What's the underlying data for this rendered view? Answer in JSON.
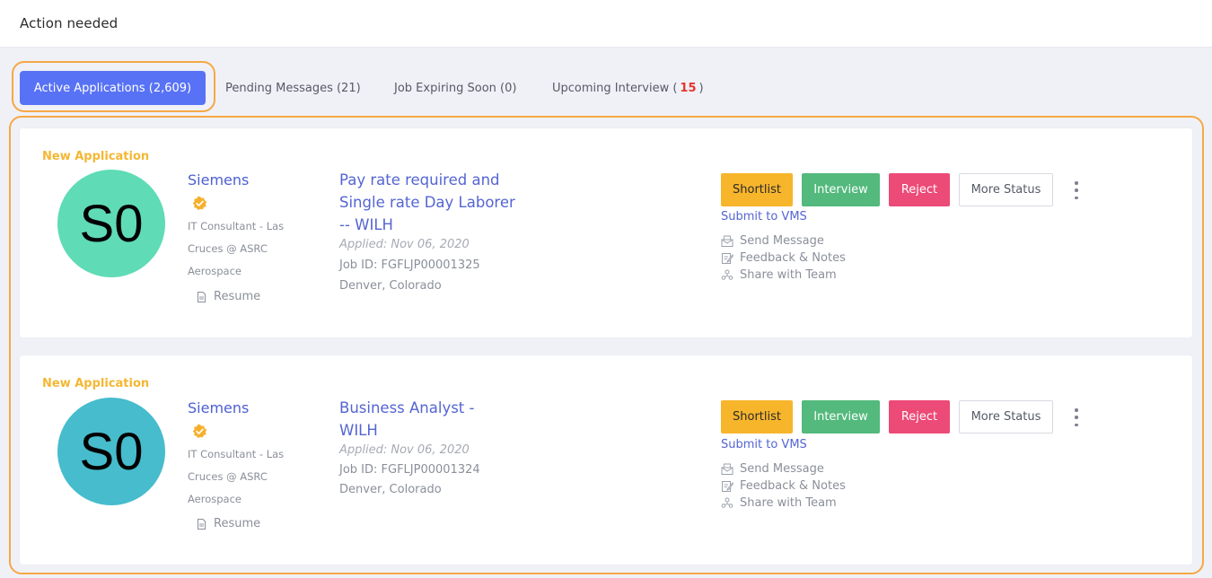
{
  "header": {
    "title": "Action needed"
  },
  "tabs": [
    {
      "label": "Active Applications (2,609)"
    },
    {
      "label": "Pending Messages (21)"
    },
    {
      "label": "Job Expiring Soon (0)"
    },
    {
      "label_prefix": "Upcoming Interview (",
      "count": "15",
      "label_suffix": ")"
    }
  ],
  "cards": [
    {
      "badge": "New Application",
      "avatar": {
        "initials": "S0",
        "color": "#5fdbb6"
      },
      "company": "Siemens",
      "role_lines": [
        "IT Consultant - Las",
        "Cruces @ ASRC",
        "Aerospace"
      ],
      "resume_label": "Resume",
      "job_title": "Pay rate required and Single rate Day Laborer -- WILH",
      "applied": "Applied: Nov 06, 2020",
      "job_id": "Job ID: FGFLJP00001325",
      "location": "Denver, Colorado",
      "buttons": {
        "shortlist": "Shortlist",
        "interview": "Interview",
        "reject": "Reject",
        "more_status": "More Status"
      },
      "submit_vms": "Submit to VMS",
      "actions": {
        "send_message": "Send Message",
        "feedback": "Feedback & Notes",
        "share": "Share with Team"
      }
    },
    {
      "badge": "New Application",
      "avatar": {
        "initials": "S0",
        "color": "#46bccd"
      },
      "company": "Siemens",
      "role_lines": [
        "IT Consultant - Las",
        "Cruces @ ASRC",
        "Aerospace"
      ],
      "resume_label": "Resume",
      "job_title": "Business Analyst - WILH",
      "applied": "Applied: Nov 06, 2020",
      "job_id": "Job ID: FGFLJP00001324",
      "location": "Denver, Colorado",
      "buttons": {
        "shortlist": "Shortlist",
        "interview": "Interview",
        "reject": "Reject",
        "more_status": "More Status"
      },
      "submit_vms": "Submit to VMS",
      "actions": {
        "send_message": "Send Message",
        "feedback": "Feedback & Notes",
        "share": "Share with Team"
      }
    }
  ],
  "colors": {
    "accent": "#5872f5",
    "highlight_outline": "#f5a845",
    "new_badge": "#f4b733",
    "verified_badge": "#f5b02e"
  },
  "icons": [
    "verified-badge-icon",
    "document-icon",
    "mail-icon",
    "edit-note-icon",
    "team-icon",
    "kebab-menu-icon"
  ]
}
